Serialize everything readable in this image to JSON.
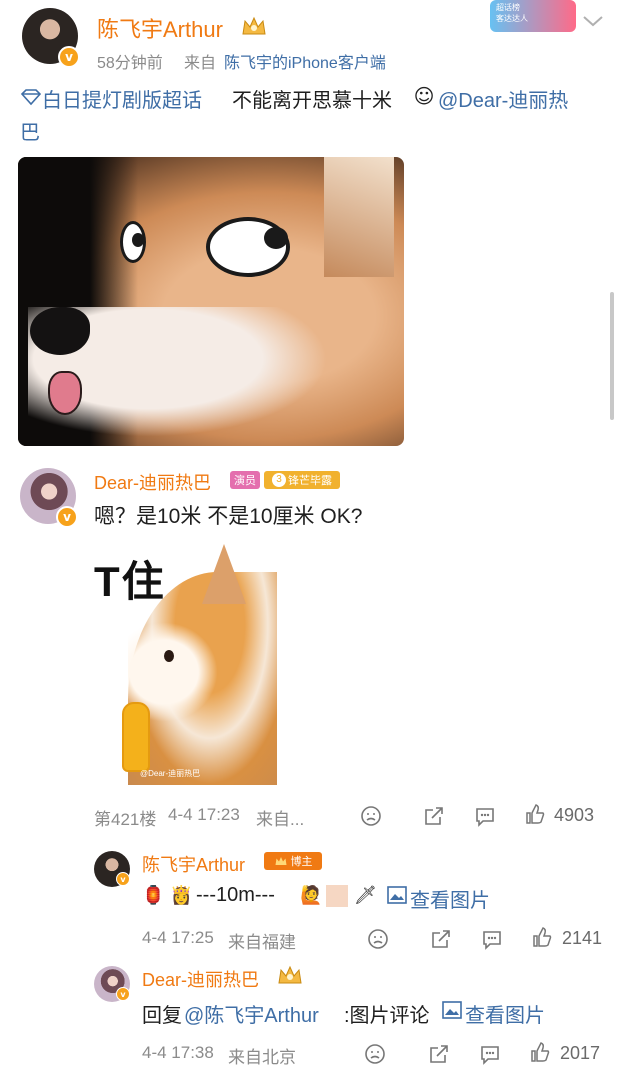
{
  "post": {
    "author": "陈飞宇Arthur",
    "time": "58分钟前",
    "source_prefix": "来自",
    "source": "陈飞宇的iPhone客户端",
    "topic": "白日提灯剧版超话",
    "text": "不能离开思慕十米",
    "mention": "@Dear-迪丽热",
    "text_wrap": "巴"
  },
  "comment1": {
    "author": "Dear-迪丽热巴",
    "tag_actor": "演员",
    "tag_fan_level": "3",
    "tag_fan": "锋芒毕露",
    "text": "嗯？是10米 不是10厘米 OK?",
    "image_caption": "T住",
    "image_watermark": "@Dear-迪丽热巴",
    "floor": "第421楼",
    "time": "4-4 17:23",
    "source": "来自...",
    "likes": "4903"
  },
  "reply1": {
    "author": "陈飞宇Arthur",
    "badge": "博主",
    "text": "---10m---",
    "view_image": "查看图片",
    "time": "4-4 17:25",
    "source": "来自福建",
    "likes": "2141"
  },
  "reply2": {
    "author": "Dear-迪丽热巴",
    "reply_prefix": "回复",
    "reply_target": "@陈飞宇Arthur",
    "reply_text": ":图片评论",
    "view_image": "查看图片",
    "time": "4-4 17:38",
    "source": "来自北京",
    "likes": "2017"
  },
  "top_badge": {
    "line1": "超话榜",
    "line2": "客达达人"
  },
  "icons": {
    "verified": "v-badge",
    "crown": "crown-icon",
    "chevron": "chevron-down-icon",
    "topic": "diamond-icon",
    "emoji_smiling_hearts": "smiling-face-with-hearts-icon",
    "react": "frown-face-icon",
    "share": "share-icon",
    "comment": "comment-icon",
    "like": "thumb-up-icon",
    "picture": "picture-icon",
    "lantern": "lantern-icon",
    "princess": "princess-icon",
    "woman": "woman-icon",
    "sword": "sword-icon"
  },
  "colors": {
    "name_orange": "#f07a13",
    "link_blue": "#3f6ea6",
    "meta_gray": "#8b8b8b",
    "verified_orange": "#f7a21b"
  }
}
